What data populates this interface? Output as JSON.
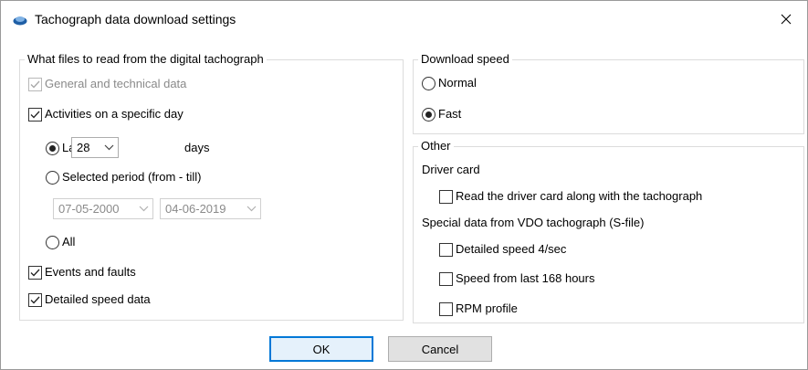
{
  "window": {
    "title": "Tachograph data download settings"
  },
  "files_group": {
    "legend": "What files to read from the digital tachograph",
    "general_label": "General and technical data",
    "activities_label": "Activities on a specific day",
    "last_label": "Last",
    "days_value": "28",
    "days_label": "days",
    "period_label": "Selected period (from - till)",
    "from_date": "07-05-2000",
    "till_date": "04-06-2019",
    "all_label": "All",
    "events_label": "Events and faults",
    "detailed_label": "Detailed speed data"
  },
  "speed_group": {
    "legend": "Download speed",
    "normal_label": "Normal",
    "fast_label": "Fast"
  },
  "other_group": {
    "legend": "Other",
    "driver_card_heading": "Driver card",
    "read_driver_card_label": "Read the driver card along with the tachograph",
    "special_heading": "Special data from VDO tachograph (S-file)",
    "detailed_speed_label": "Detailed speed 4/sec",
    "speed_168_label": "Speed from last 168 hours",
    "rpm_label": "RPM profile"
  },
  "buttons": {
    "ok": "OK",
    "cancel": "Cancel"
  }
}
